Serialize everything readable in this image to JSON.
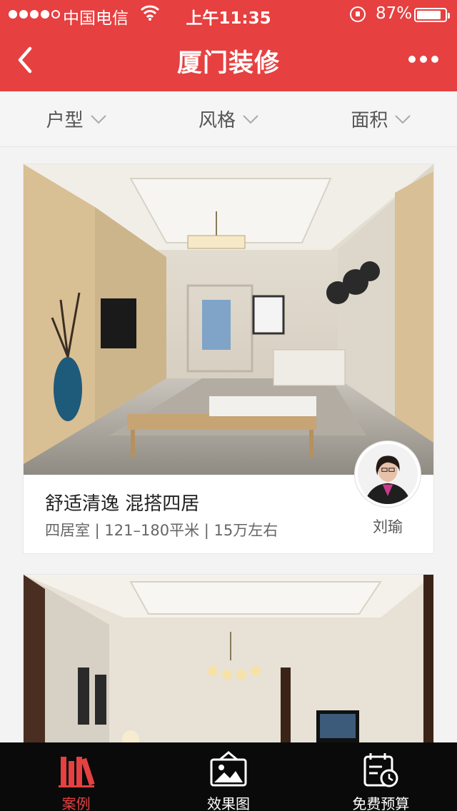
{
  "status_bar": {
    "carrier": "中国电信",
    "time": "上午11:35",
    "battery_percent": "87%",
    "battery_level": 0.87
  },
  "nav": {
    "title": "厦门装修"
  },
  "filters": [
    {
      "label": "户型"
    },
    {
      "label": "风格"
    },
    {
      "label": "面积"
    }
  ],
  "cases": [
    {
      "title": "舒适清逸 混搭四居",
      "meta": "四居室 | 121–180平米 | 15万左右",
      "designer": "刘瑜"
    }
  ],
  "tabs": [
    {
      "label": "案例",
      "active": true
    },
    {
      "label": "效果图",
      "active": false
    },
    {
      "label": "免费预算",
      "active": false
    }
  ],
  "colors": {
    "accent": "#e64041",
    "tabbar_bg": "#0a0a0a",
    "filter_bg": "#f5f5f5"
  }
}
